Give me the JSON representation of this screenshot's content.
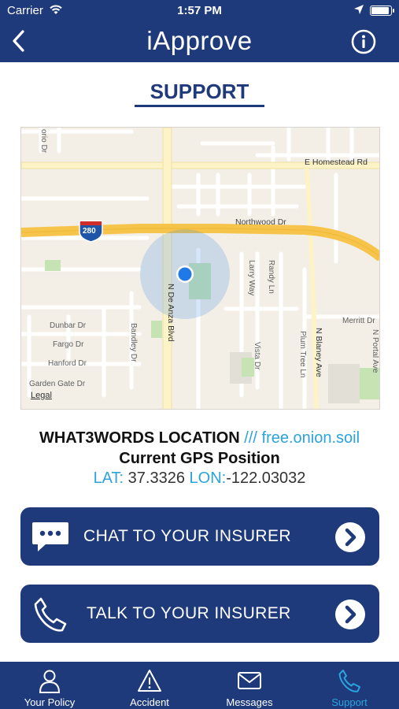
{
  "status_bar": {
    "carrier": "Carrier",
    "time": "1:57 PM"
  },
  "nav": {
    "title": "iApprove",
    "back_icon": "chevron-left-icon",
    "info_icon": "info-icon"
  },
  "section": {
    "title": "SUPPORT"
  },
  "map": {
    "labels": {
      "e_homestead": "E Homestead Rd",
      "northwood": "Northwood Dr",
      "de_anza": "N De Anza Blvd",
      "larry": "Larry Way",
      "randy": "Randy Ln",
      "dunbar": "Dunbar Dr",
      "fargo": "Fargo Dr",
      "hanford": "Hanford Dr",
      "garden_gate": "Garden Gate Dr",
      "bandley": "Bandley Dr",
      "vista": "Vista Dr",
      "plum_tree": "Plum Tree Ln",
      "blaney": "N Blaney Ave",
      "merritt": "Merritt Dr",
      "portal": "N Portal Ave",
      "orio": "orio Dr",
      "interstate": "280"
    },
    "legal": "Legal"
  },
  "location": {
    "w3w_label": "WHAT3WORDS LOCATION",
    "w3w_slashes": "///",
    "w3w_words": "free.onion.soil",
    "gps_title": "Current GPS Position",
    "lat_label": "LAT:",
    "lat_value": "37.3326",
    "lon_label": "LON:",
    "lon_value": "-122.03032"
  },
  "actions": {
    "chat": {
      "label": "CHAT TO YOUR INSURER",
      "icon": "chat-bubble-icon"
    },
    "talk": {
      "label": "TALK TO YOUR INSURER",
      "icon": "phone-icon"
    }
  },
  "tabs": [
    {
      "label": "Your Policy",
      "icon": "person-icon"
    },
    {
      "label": "Accident",
      "icon": "warning-icon"
    },
    {
      "label": "Messages",
      "icon": "envelope-icon"
    },
    {
      "label": "Support",
      "icon": "phone-icon",
      "active": true
    }
  ],
  "colors": {
    "brand_navy": "#1e3a7b",
    "accent_blue": "#2ba3dd",
    "location_dot": "#1f7ae8"
  }
}
